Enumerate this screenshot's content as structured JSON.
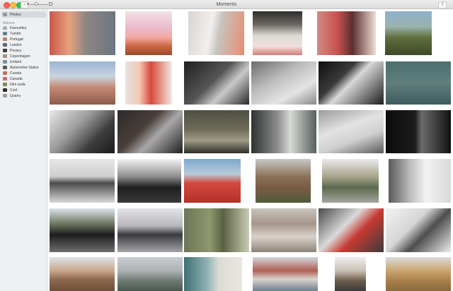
{
  "window": {
    "title": "Moments"
  },
  "toolbar": {
    "back_glyph": "‹",
    "share_glyph": "⇪"
  },
  "sidebar": {
    "library_item": {
      "label": "Photos",
      "icon": "photos-icon"
    },
    "albums_header": "Albums",
    "albums": [
      {
        "label": "Favourites",
        "icon": "heart-icon",
        "color": "#a8a8a8"
      },
      {
        "label": "Tumblr",
        "icon": "album-thumb-icon",
        "color": "#6d7f8e"
      },
      {
        "label": "Portugal",
        "icon": "album-thumb-icon",
        "color": "#b9856e"
      },
      {
        "label": "London",
        "icon": "album-thumb-icon",
        "color": "#5d6874"
      },
      {
        "label": "Privacy",
        "icon": "album-thumb-icon",
        "color": "#3f3f3f"
      },
      {
        "label": "Copenhagen",
        "icon": "album-thumb-icon",
        "color": "#a9927a"
      },
      {
        "label": "Iceland",
        "icon": "album-thumb-icon",
        "color": "#7c8f9a"
      },
      {
        "label": "Automotive Status",
        "icon": "album-thumb-icon",
        "color": "#55595e"
      },
      {
        "label": "Croatia",
        "icon": "album-thumb-icon",
        "color": "#b97458"
      },
      {
        "label": "Canada",
        "icon": "album-thumb-icon",
        "color": "#c96b7a"
      },
      {
        "label": "Film soda",
        "icon": "album-thumb-icon",
        "color": "#7b8a5e"
      },
      {
        "label": "Cool",
        "icon": "album-thumb-icon",
        "color": "#2c2c2c"
      },
      {
        "label": "Quarry",
        "icon": "album-thumb-icon",
        "color": "#9e9e9e"
      }
    ]
  },
  "photos": [
    [
      {
        "name": "photo-car-street-light-leak",
        "bg": "linear-gradient(90deg,#c9574a 0%,#e5a27f 30%,#8d8683 55%,#6c7680 100%)"
      },
      {
        "name": "photo-pink-sunset-horizon",
        "bg": "linear-gradient(180deg,#f3e2e6 0%,#eab8c8 40%,#f4a8a0 60%,#c9663f 80%,#9b4a2c 100%)"
      },
      {
        "name": "photo-white-staircase",
        "bg": "linear-gradient(100deg,#d9d3cf 0%,#f2f0ee 40%,#c8c3bf 55%,#e98c6e 100%)"
      },
      {
        "name": "photo-cliff-ocean",
        "bg": "linear-gradient(180deg,#2e2f2d 0%,#6a6660 30%,#dbd8d3 55%,#efe0dd 80%,#d47c76 100%)"
      },
      {
        "name": "photo-woman-backpack",
        "bg": "linear-gradient(90deg,#d38a82 0%,#c7514f 35%,#5a2f2d 60%,#f0dcd6 100%)"
      },
      {
        "name": "photo-green-hill",
        "bg": "linear-gradient(180deg,#8eb0cc 0%,#9ab3b0 35%,#5f6e3c 60%,#3e4a28 100%)"
      }
    ],
    [
      {
        "name": "photo-coast-rocks",
        "bg": "linear-gradient(180deg,#9bb5d2 0%,#c9d4df 35%,#c58a75 60%,#8c5a4c 100%)"
      },
      {
        "name": "photo-desert-light-leak",
        "bg": "linear-gradient(90deg,#e7e2df 0%,#f5c8b6 30%,#d94a3c 55%,#f2e8e3 100%)"
      },
      {
        "name": "photo-hand-phone-bw",
        "bg": "linear-gradient(135deg,#1f1f1f 0%,#555 45%,#c9c9c9 65%,#2a2a2a 100%)"
      },
      {
        "name": "photo-cyclist-bw",
        "bg": "linear-gradient(150deg,#6b6b6b 0%,#bdbdbd 40%,#e4e4e4 70%,#8a8a8a 100%)"
      },
      {
        "name": "photo-architecture-bw",
        "bg": "linear-gradient(135deg,#0e0e0e 0%,#3a3a3a 35%,#d8d8d8 50%,#1c1c1c 100%)"
      },
      {
        "name": "photo-teal-water",
        "bg": "linear-gradient(180deg,#4d6e6e 0%,#5f7f7d 50%,#3e5c5d 100%)"
      }
    ],
    [
      {
        "name": "photo-hand-lighter-bw",
        "bg": "linear-gradient(135deg,#e8e8e8 0%,#9c9c9c 40%,#3c3c3c 70%,#1a1a1a 100%)"
      },
      {
        "name": "photo-phone-hands-dark",
        "bg": "linear-gradient(135deg,#2b2b2b 0%,#4a3f3a 40%,#a9a8a8 60%,#1f1f1f 100%)"
      },
      {
        "name": "photo-blurred-street",
        "bg": "linear-gradient(180deg,#4e4f44 0%,#6e6c58 45%,#9f9b86 70%,#2e2e28 100%)"
      },
      {
        "name": "photo-street-storefront",
        "bg": "linear-gradient(90deg,#2f3231 0%,#8a8d8a 40%,#d9d9d7 60%,#55605b 100%)"
      },
      {
        "name": "photo-white-car-bw",
        "bg": "linear-gradient(160deg,#9b9b9b 0%,#e3e3e3 40%,#cfcfcf 65%,#5a5a5a 100%)"
      },
      {
        "name": "photo-dark-window",
        "bg": "linear-gradient(90deg,#0c0c0c 0%,#1b1b1b 45%,#6b6b6b 55%,#111 100%)"
      }
    ],
    [
      {
        "name": "photo-living-room-tv",
        "bg": "linear-gradient(180deg,#e6e6e6 0%,#cfcfcf 40%,#4b4b4b 55%,#d9d9d9 100%)"
      },
      {
        "name": "photo-bicycles-window",
        "bg": "linear-gradient(180deg,#f2f2f2 0%,#8e8e8e 40%,#1e1e1e 65%,#3a3a3a 100%)"
      },
      {
        "name": "photo-red-bus",
        "bg": "linear-gradient(180deg,#7ea9cf 0%,#b6cbd9 35%,#d3493e 55%,#b23028 100%)"
      },
      {
        "name": "photo-garden-shed",
        "bg": "linear-gradient(180deg,#c9c9c7 0%,#8a7359 40%,#7a5c45 65%,#4e5b3a 100%)"
      },
      {
        "name": "photo-terrace-plants",
        "bg": "linear-gradient(180deg,#eaeaea 0%,#a9a48d 40%,#5c6b4d 65%,#a4a49e 100%)"
      },
      {
        "name": "photo-room-curtains",
        "bg": "linear-gradient(90deg,#5a5a5a 0%,#bdbdbd 35%,#f2f2f2 60%,#d9d9d9 100%)"
      }
    ],
    [
      {
        "name": "photo-garage-trees",
        "bg": "linear-gradient(180deg,#dbe4ec 0%,#6d7861 35%,#1e1e1e 60%,#6e6e6e 100%)"
      },
      {
        "name": "photo-pier-sea",
        "bg": "linear-gradient(180deg,#e4e4e6 0%,#b7b7bd 40%,#3b3b3f 60%,#a4a4a8 100%)"
      },
      {
        "name": "photo-green-wall-lamp",
        "bg": "linear-gradient(90deg,#6c7556 0%,#8e976d 40%,#5a6143 60%,#c9ccb4 100%)"
      },
      {
        "name": "photo-people-walking",
        "bg": "linear-gradient(180deg,#c9c4bd 0%,#a6968a 35%,#d9d2ca 65%,#8e8378 100%)"
      },
      {
        "name": "photo-motorbike-red",
        "bg": "linear-gradient(135deg,#4a4a4a 0%,#d9d9d9 40%,#c73a32 60%,#3b3b3b 100%)"
      },
      {
        "name": "photo-white-building-bw",
        "bg": "linear-gradient(135deg,#f2f2f2 0%,#d6d6d6 40%,#4d4d4d 60%,#ededed 100%)"
      }
    ],
    [
      {
        "name": "photo-quarry-mountain",
        "bg": "linear-gradient(180deg,#dfe4ea 0%,#c9a88d 40%,#8f6a50 65%,#6e4f3a 100%)"
      },
      {
        "name": "photo-misty-coast",
        "bg": "linear-gradient(180deg,#c8ccd0 0%,#aeb3b6 40%,#6e7a72 70%,#4c574f 100%)"
      },
      {
        "name": "photo-teal-facade",
        "bg": "linear-gradient(90deg,#3f6f73 0%,#8fb2b2 40%,#dcdcd8 60%,#e9e6dc 100%)"
      },
      {
        "name": "photo-city-rooftops",
        "bg": "linear-gradient(180deg,#cfd6dc 0%,#b25f55 40%,#d9d4cc 65%,#6e7f8e 100%)"
      },
      {
        "name": "photo-road-figure",
        "bg": "linear-gradient(180deg,#f0eeec 0%,#c9c1b5 40%,#6d5c4a 70%,#3b3b3b 100%)"
      },
      {
        "name": "photo-pallet-stacks",
        "bg": "linear-gradient(180deg,#dcdcdc 0%,#c9a56f 40%,#a9804c 70%,#8a6a3e 100%)"
      }
    ]
  ]
}
